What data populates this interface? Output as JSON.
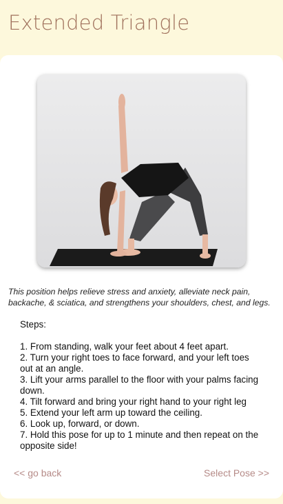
{
  "header": {
    "title": "Extended Triangle"
  },
  "pose": {
    "description": "This position helps relieve stress and anxiety, alleviate neck pain, backache, & sciatica, and strengthens your shoulders, chest, and legs.",
    "steps_heading": "Steps:",
    "steps": [
      "1. From standing, walk your feet about 4 feet apart.",
      "2. Turn your right toes to face forward, and your left toes out at an angle.",
      "3. Lift your arms parallel to the floor with your palms facing down.",
      "4. Tilt forward and bring your right hand to your right leg",
      "5. Extend your left arm up toward the ceiling.",
      "6. Look up, forward, or down.",
      "7. Hold this pose for up to 1 minute and then repeat on the opposite side!"
    ]
  },
  "nav": {
    "back_label": "<< go back",
    "next_label": "Select Pose >>"
  },
  "colors": {
    "background": "#fdf8dc",
    "title": "#a0715c",
    "link": "#b58a87"
  }
}
